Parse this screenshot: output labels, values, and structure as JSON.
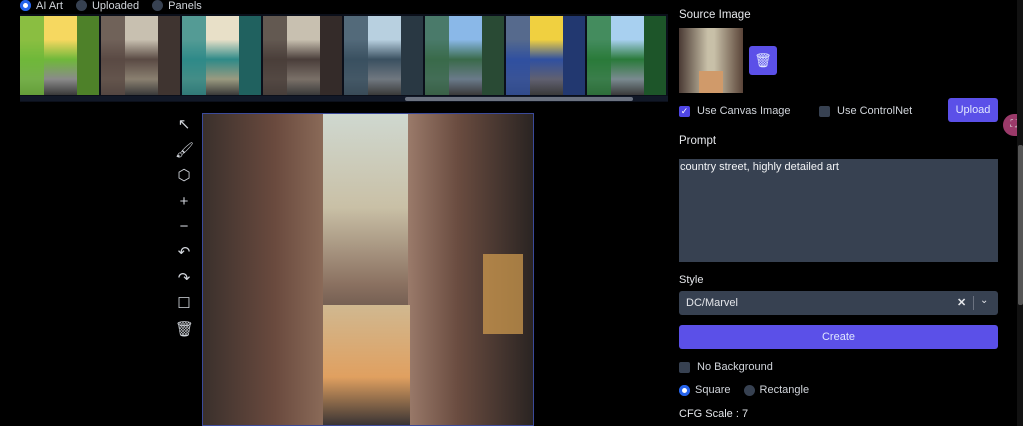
{
  "source_tabs": [
    {
      "label": "AI Art",
      "selected": true
    },
    {
      "label": "Uploaded",
      "selected": false
    },
    {
      "label": "Panels",
      "selected": false
    }
  ],
  "gallery": {
    "thumbnail_count": 8,
    "scroll_position": 0.65
  },
  "toolbar": [
    {
      "icon": "arrow-up-left-icon",
      "glyph": "↖"
    },
    {
      "icon": "brush-icon",
      "glyph": "🖌"
    },
    {
      "icon": "cube-icon",
      "glyph": "⬡"
    },
    {
      "icon": "plus-icon",
      "glyph": "+"
    },
    {
      "icon": "minus-icon",
      "glyph": "−"
    },
    {
      "icon": "undo-icon",
      "glyph": "↶"
    },
    {
      "icon": "redo-icon",
      "glyph": "↷"
    },
    {
      "icon": "square-icon",
      "glyph": "☐"
    },
    {
      "icon": "trash-icon",
      "glyph": "🗑"
    }
  ],
  "panel": {
    "source_image_label": "Source Image",
    "use_canvas_label": "Use Canvas Image",
    "use_canvas_checked": true,
    "use_controlnet_label": "Use ControlNet",
    "use_controlnet_checked": false,
    "upload_label": "Upload",
    "prompt_label": "Prompt",
    "prompt_value": "country street, highly detailed art",
    "style_label": "Style",
    "style_value": "DC/Marvel",
    "create_label": "Create",
    "no_background_label": "No Background",
    "no_background_checked": false,
    "shape_options": [
      {
        "label": "Square",
        "selected": true
      },
      {
        "label": "Rectangle",
        "selected": false
      }
    ],
    "cfg_label": "CFG Scale : 7"
  },
  "colors": {
    "accent": "#5b50e8",
    "input_bg": "#374151",
    "radio_on": "#2563eb"
  }
}
